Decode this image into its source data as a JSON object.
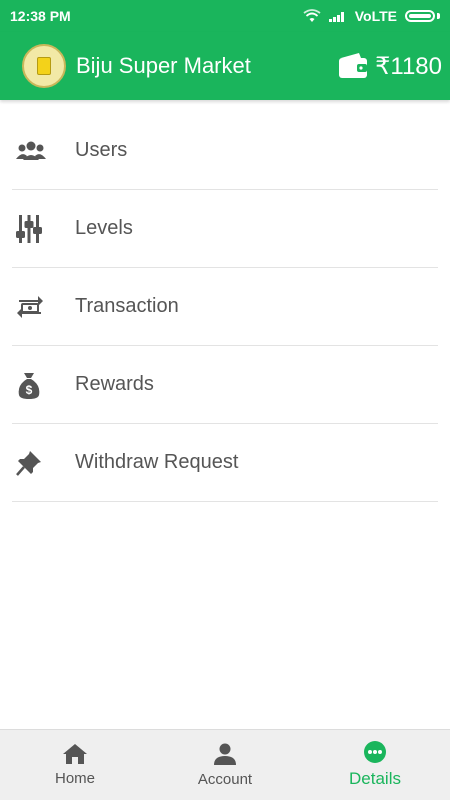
{
  "status_bar": {
    "time": "12:38 PM",
    "network": "VoLTE"
  },
  "header": {
    "title": "Biju Super Market",
    "wallet_amount": "₹1180",
    "colors": {
      "primary": "#1ab55c"
    }
  },
  "menu": {
    "items": [
      {
        "label": "Users",
        "icon": "users-icon"
      },
      {
        "label": "Levels",
        "icon": "levels-icon"
      },
      {
        "label": "Transaction",
        "icon": "transaction-icon"
      },
      {
        "label": "Rewards",
        "icon": "money-bag-icon"
      },
      {
        "label": "Withdraw Request",
        "icon": "pin-icon"
      }
    ]
  },
  "bottom_nav": {
    "items": [
      {
        "label": "Home",
        "icon": "home-icon"
      },
      {
        "label": "Account",
        "icon": "account-icon"
      },
      {
        "label": "Details",
        "icon": "more-icon",
        "active": true
      }
    ]
  }
}
